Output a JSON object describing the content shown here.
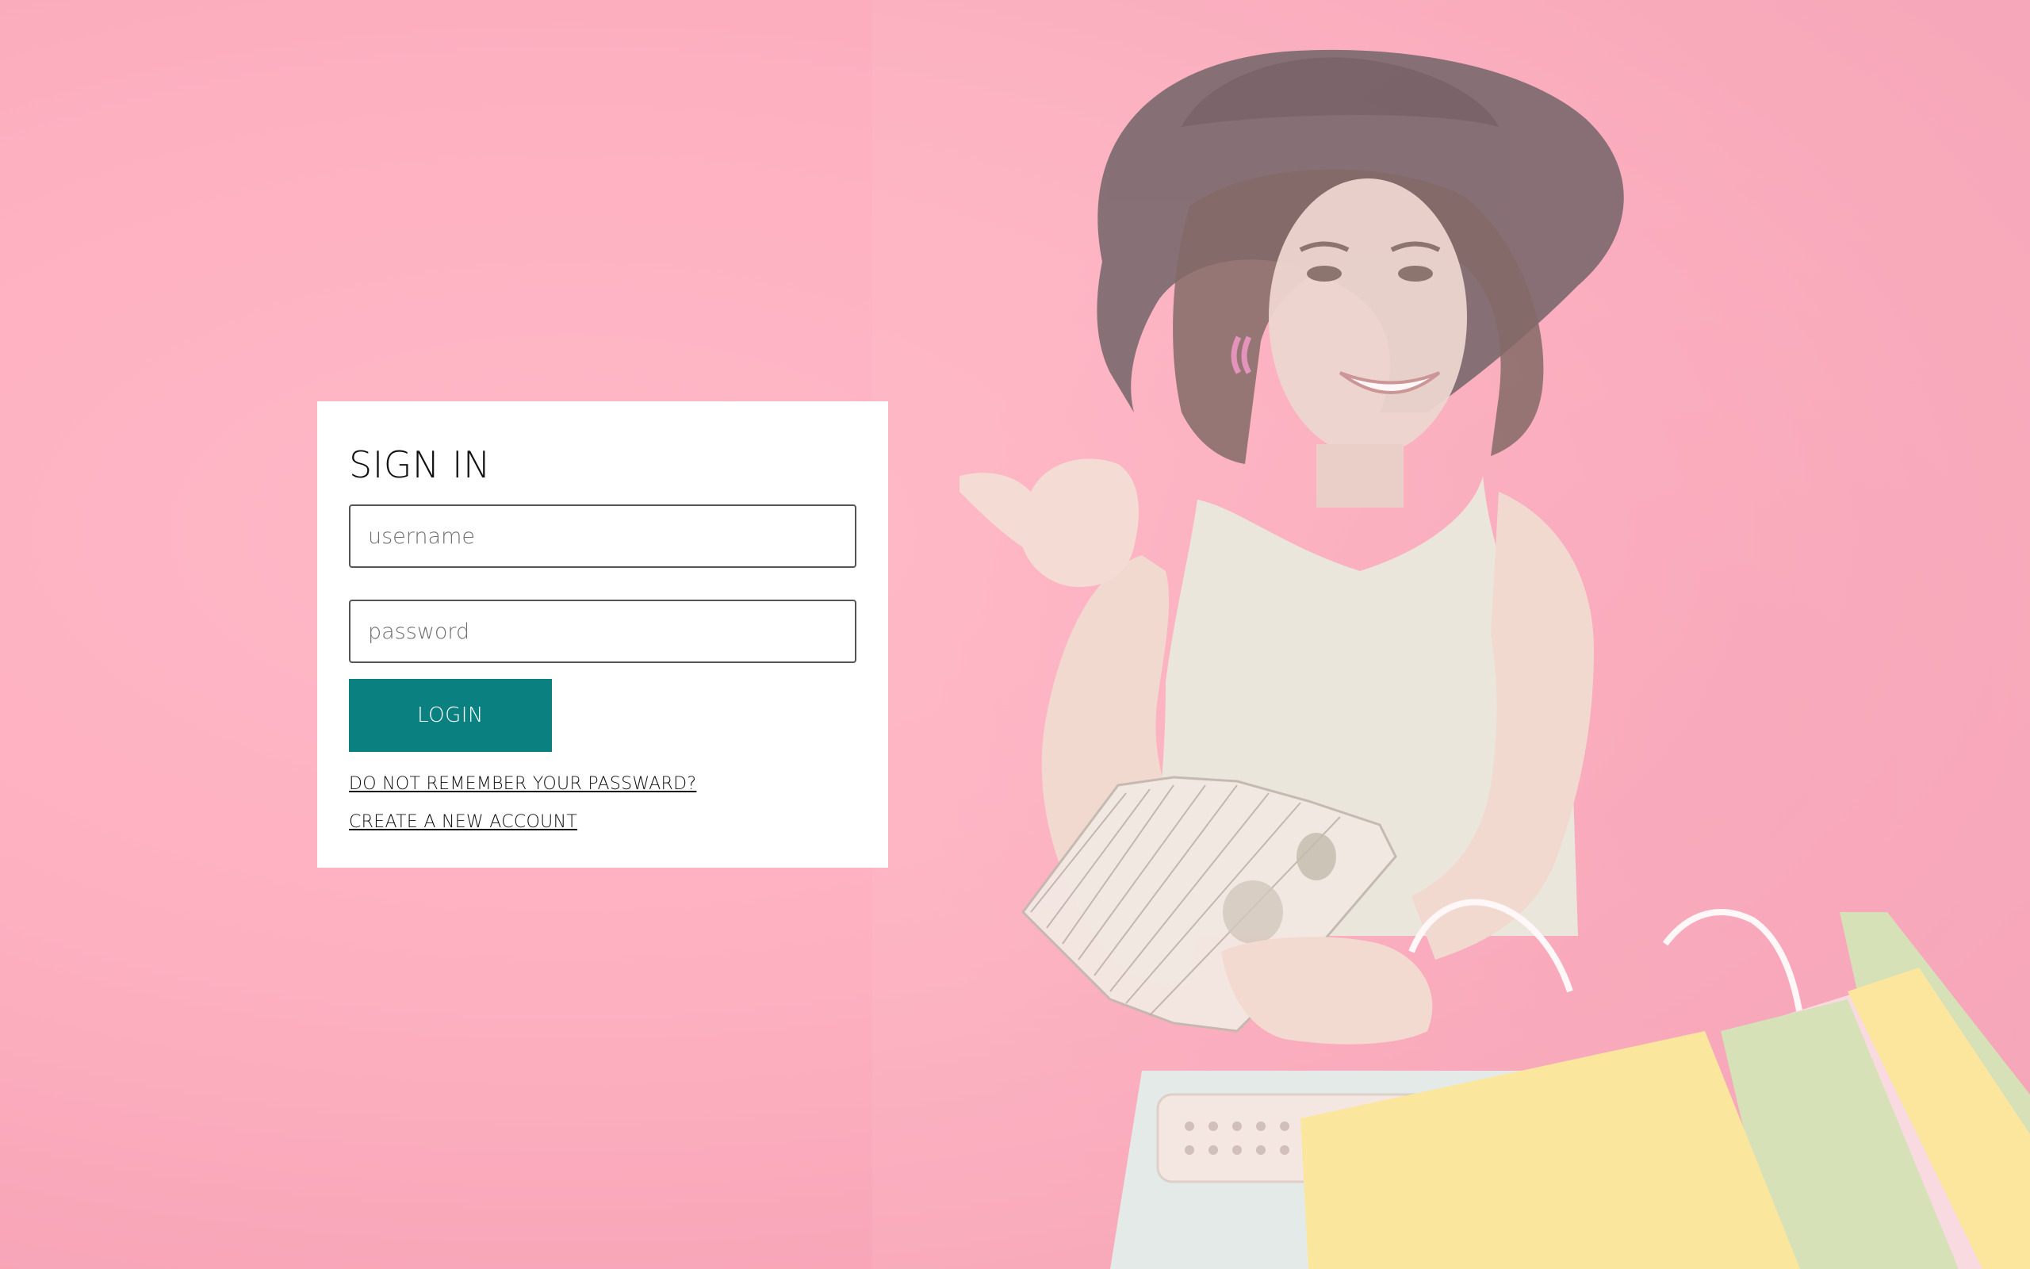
{
  "signin": {
    "title": "SIGN IN",
    "username_placeholder": "username",
    "password_placeholder": "password",
    "login_label": "LOGIN",
    "forgot_link": "DO NOT REMEMBER YOUR PASSWARD?",
    "create_link": "CREATE A NEW ACCOUNT"
  },
  "colors": {
    "background": "#fdb0c0",
    "card": "#ffffff",
    "button": "#0a8080",
    "button_text": "#ffffff"
  },
  "hero_image": {
    "icon": "woman-with-shopping-bags-illustration"
  }
}
